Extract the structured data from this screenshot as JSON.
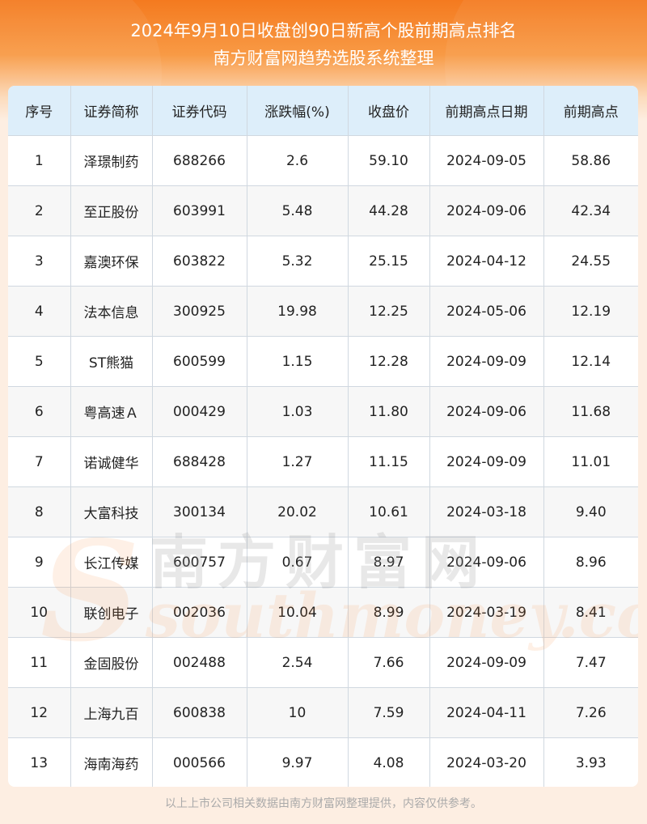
{
  "header": {
    "title_line1": "2024年9月10日收盘创90日新高个股前期高点排名",
    "title_line2": "南方财富网趋势选股系统整理"
  },
  "table": {
    "columns": [
      "序号",
      "证券简称",
      "证券代码",
      "涨跌幅(%)",
      "收盘价",
      "前期高点日期",
      "前期高点"
    ],
    "rows": [
      [
        "1",
        "泽璟制药",
        "688266",
        "2.6",
        "59.10",
        "2024-09-05",
        "58.86"
      ],
      [
        "2",
        "至正股份",
        "603991",
        "5.48",
        "44.28",
        "2024-09-06",
        "42.34"
      ],
      [
        "3",
        "嘉澳环保",
        "603822",
        "5.32",
        "25.15",
        "2024-04-12",
        "24.55"
      ],
      [
        "4",
        "法本信息",
        "300925",
        "19.98",
        "12.25",
        "2024-05-06",
        "12.19"
      ],
      [
        "5",
        "ST熊猫",
        "600599",
        "1.15",
        "12.28",
        "2024-09-09",
        "12.14"
      ],
      [
        "6",
        "粤高速Ａ",
        "000429",
        "1.03",
        "11.80",
        "2024-09-06",
        "11.68"
      ],
      [
        "7",
        "诺诚健华",
        "688428",
        "1.27",
        "11.15",
        "2024-09-09",
        "11.01"
      ],
      [
        "8",
        "大富科技",
        "300134",
        "20.02",
        "10.61",
        "2024-03-18",
        "9.40"
      ],
      [
        "9",
        "长江传媒",
        "600757",
        "0.67",
        "8.97",
        "2024-09-06",
        "8.96"
      ],
      [
        "10",
        "联创电子",
        "002036",
        "10.04",
        "8.99",
        "2024-03-19",
        "8.41"
      ],
      [
        "11",
        "金固股份",
        "002488",
        "2.54",
        "7.66",
        "2024-09-09",
        "7.47"
      ],
      [
        "12",
        "上海九百",
        "600838",
        "10",
        "7.59",
        "2024-04-11",
        "7.26"
      ],
      [
        "13",
        "海南海药",
        "000566",
        "9.97",
        "4.08",
        "2024-03-20",
        "3.93"
      ]
    ]
  },
  "watermark": {
    "brand_cn": "南方财富网",
    "brand_en": "southmoney.com"
  },
  "footer": {
    "disclaimer": "以上上市公司相关数据由南方财富网整理提供，内容仅供参考。"
  },
  "colors": {
    "header_orange": "#f47a1f",
    "table_header_bg": "#ddeefa",
    "stripe_bg": "#f7f7f7"
  }
}
